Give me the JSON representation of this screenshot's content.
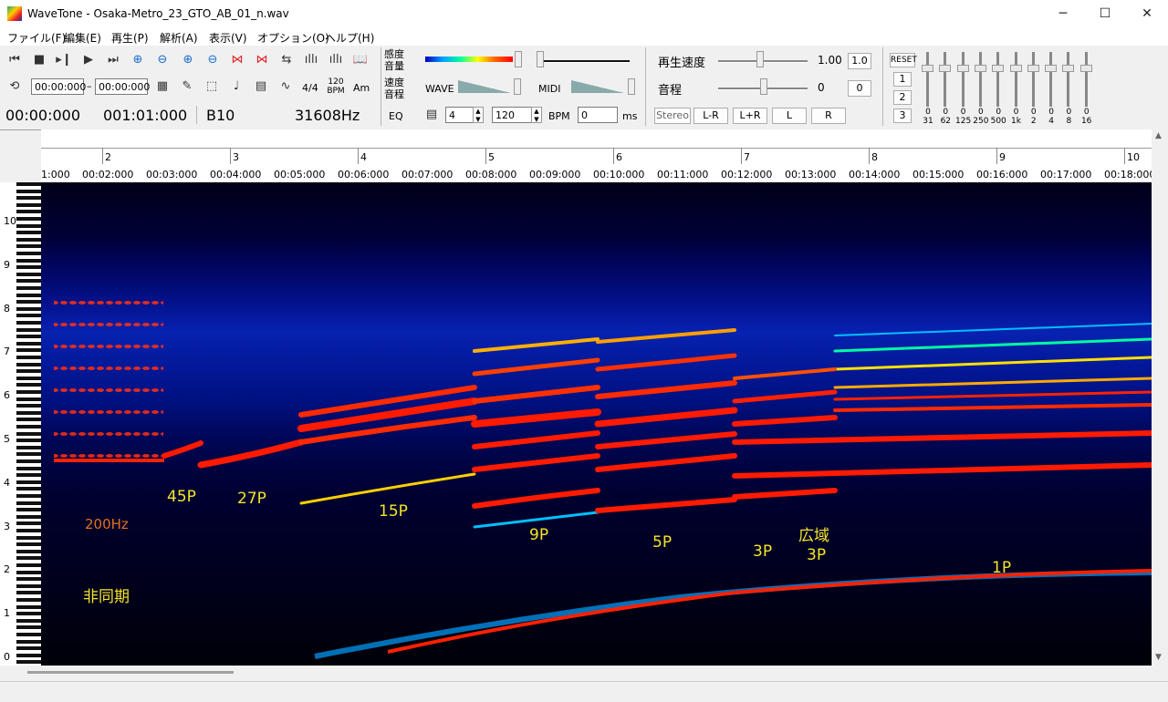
{
  "window": {
    "title": "WaveTone - Osaka-Metro_23_GTO_AB_01_n.wav",
    "minimize": "─",
    "maximize": "☐",
    "close": "✕"
  },
  "menu": [
    "ファイル(F)",
    "編集(E)",
    "再生(P)",
    "解析(A)",
    "表示(V)",
    "オプション(O)",
    "ヘルプ(H)"
  ],
  "toolbar": {
    "start_time": "00:00:000",
    "range_dash": "–",
    "end_time": "00:00:000",
    "time_sig": "4/4",
    "bpm_icon_top": "120",
    "bpm_icon_bottom": "BPM",
    "am_label": "Am",
    "sensitivity_label_1": "感度",
    "sensitivity_label_2": "音量",
    "speed_label_1": "速度",
    "speed_label_2": "音程",
    "eq_label": "EQ",
    "wave_label": "WAVE",
    "midi_label": "MIDI",
    "beats_value": "4",
    "bpm_value": "120",
    "bpm_label": "BPM",
    "offset_value": "0",
    "ms_label": "ms",
    "playback_speed_label": "再生速度",
    "playback_speed_value": "1.00",
    "playback_speed_reset": "1.0",
    "pitch_label": "音程",
    "pitch_value": "0",
    "pitch_reset": "0",
    "stereo": "Stereo",
    "l_minus_r": "L-R",
    "l_plus_r": "L+R",
    "left": "L",
    "right": "R",
    "reset": "RESET",
    "preset_1": "1",
    "preset_2": "2",
    "preset_3": "3"
  },
  "status": {
    "current_time": "00:00:000",
    "position": "001:01:000",
    "note": "B10",
    "frequency": "31608Hz"
  },
  "eq_bands": [
    "31",
    "62",
    "125",
    "250",
    "500",
    "1k",
    "2",
    "4",
    "8",
    "16"
  ],
  "eq_values": [
    "0",
    "0",
    "0",
    "0",
    "0",
    "0",
    "0",
    "0",
    "0",
    "0"
  ],
  "ruler": {
    "bars": [
      "2",
      "3",
      "4",
      "5",
      "6",
      "7",
      "8",
      "9",
      "10"
    ],
    "times": [
      "1:000",
      "00:02:000",
      "00:03:000",
      "00:04:000",
      "00:05:000",
      "00:06:000",
      "00:07:000",
      "00:08:000",
      "00:09:000",
      "00:10:000",
      "00:11:000",
      "00:12:000",
      "00:13:000",
      "00:14:000",
      "00:15:000",
      "00:16:000",
      "00:17:000",
      "00:18:000"
    ]
  },
  "octaves": [
    "10",
    "9",
    "8",
    "7",
    "6",
    "5",
    "4",
    "3",
    "2",
    "1",
    "0"
  ],
  "annotations": {
    "a45p": "45P",
    "a27p": "27P",
    "a15p": "15P",
    "a9p": "9P",
    "a5p": "5P",
    "a3p": "3P",
    "wide_1": "広域",
    "wide_2": "3P",
    "a1p": "1P",
    "hz200": "200Hz",
    "async": "非同期"
  }
}
